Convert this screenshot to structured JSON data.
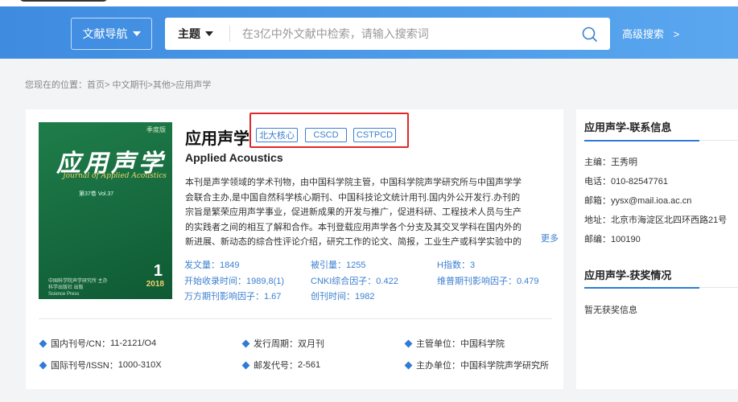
{
  "header": {
    "nav_label": "文献导航",
    "topic_label": "主题",
    "search_placeholder": "在3亿中外文献中检索，请输入搜索词",
    "advanced_label": "高级搜索",
    "advanced_arrow": ">",
    "accent": "#3e8be0"
  },
  "breadcrumb": "您现在的位置：首页> 中文期刊>其他>应用声学",
  "journal": {
    "title": "应用声学",
    "badges": [
      "北大核心",
      "CSCD",
      "CSTPCD"
    ],
    "english_title": "Applied Acoustics",
    "description": "本刊是声学领域的学术刊物，由中国科学院主管，中国科学院声学研究所与中国声学学会联合主办,是中国自然科学核心期刊、中国科技论文统计用刊.国内外公开发行.办刊的宗旨是繁荣应用声学事业，促进新成果的开发与推广，促进科研、工程技术人员与生产的实践者之间的相互了解和合作。本刊登载应用声学各个分支及其交叉学科在国内外的新进展、新动态的综合性评论介绍，研究工作的论文、简报，工业生产或科学实验中的技术成果，制作工艺的革新与",
    "more_label": "更多",
    "cover": {
      "tag": "季度版",
      "title": "应用声学",
      "subtitle": "Journal of Applied Acoustics",
      "volume": "第37卷  Vol.37",
      "issue": "1",
      "year": "2018",
      "publisher": "中国科学院声学研究所 主办\n科学出版社 出版\nScience Press"
    },
    "stats": [
      {
        "label": "发文量：",
        "value": "1849"
      },
      {
        "label": "被引量：",
        "value": "1255"
      },
      {
        "label": "H指数：",
        "value": "3"
      },
      {
        "label": "开始收录时间：",
        "value": "1989,8(1)"
      },
      {
        "label": "CNKI综合因子：",
        "value": "0.422"
      },
      {
        "label": "维普期刊影响因子：",
        "value": "0.479"
      },
      {
        "label": "万方期刊影响因子：",
        "value": "1.67"
      },
      {
        "label": "创刊时间：",
        "value": "1982"
      }
    ],
    "info": [
      {
        "label": "国内刊号/CN：",
        "value": "11-2121/O4"
      },
      {
        "label": "发行周期：",
        "value": "双月刊"
      },
      {
        "label": "主管单位：",
        "value": "中国科学院"
      },
      {
        "label": "国际刊号/ISSN：",
        "value": "1000-310X"
      },
      {
        "label": "邮发代号：",
        "value": "2-561"
      },
      {
        "label": "主办单位：",
        "value": "中国科学院声学研究所"
      }
    ]
  },
  "sidebar": {
    "contact_title": "应用声学-联系信息",
    "contacts": [
      "主编：王秀明",
      "电话：010-82547761",
      "邮箱：yysx@mail.ioa.ac.cn",
      "地址：北京市海淀区北四环西路21号",
      "邮编：100190"
    ],
    "awards_title": "应用声学-获奖情况",
    "awards_text": "暂无获奖信息"
  }
}
